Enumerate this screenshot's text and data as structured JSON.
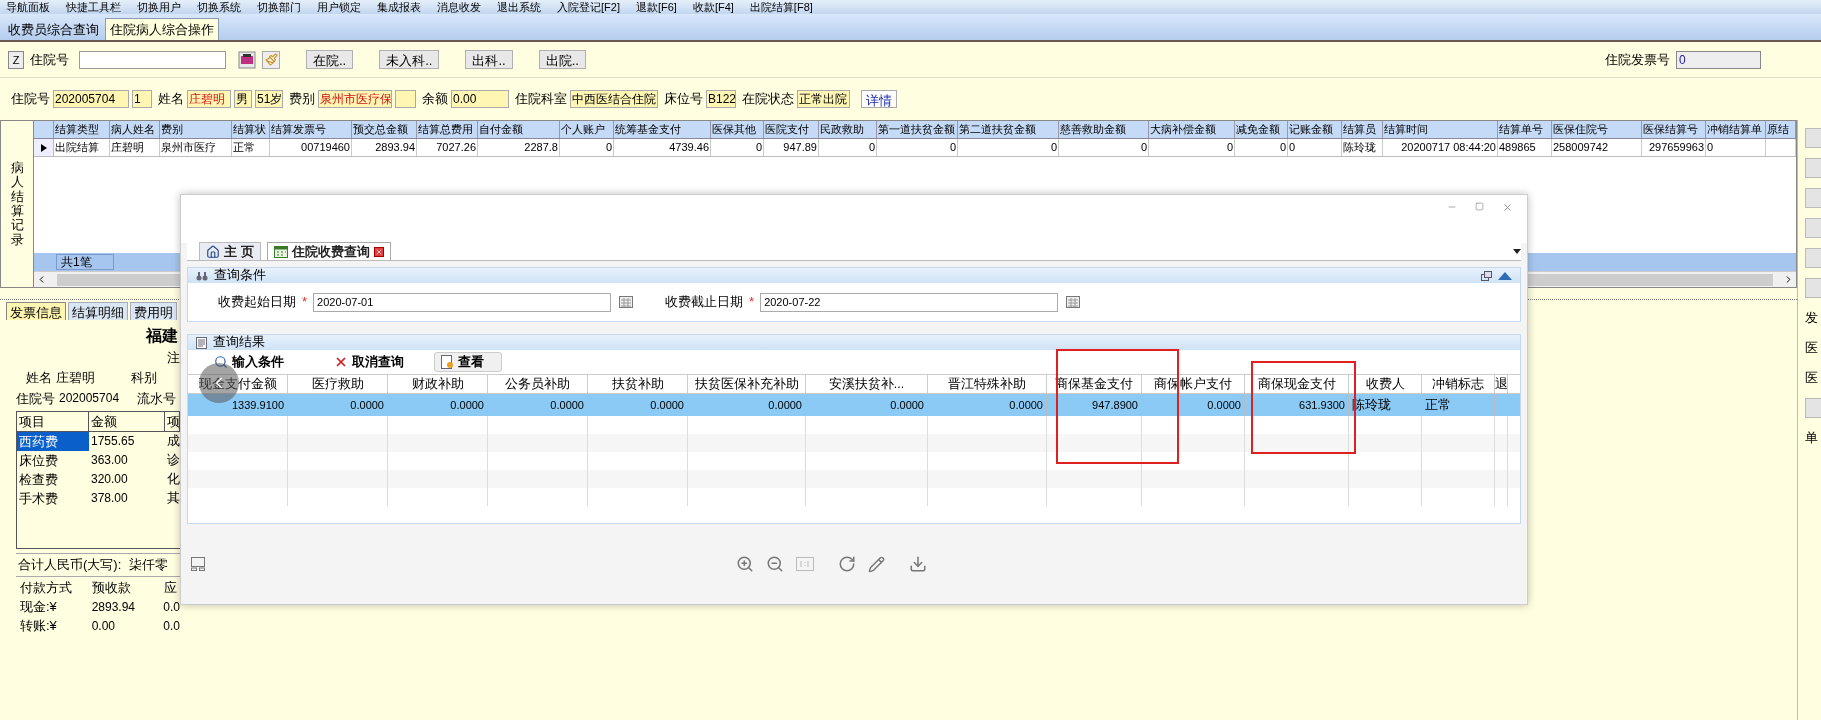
{
  "toolbar": [
    "导航面板",
    "快捷工具栏",
    "切换用户",
    "切换系统",
    "切换部门",
    "用户锁定",
    "集成报表",
    "消息收发",
    "退出系统",
    "入院登记[F2]",
    "退款[F6]",
    "收款[F4]",
    "出院结算[F8]"
  ],
  "main_tabs": [
    {
      "label": "收费员综合查询",
      "selected": false
    },
    {
      "label": "住院病人综合操作",
      "selected": true
    }
  ],
  "search_row": {
    "z_button": "Z",
    "label": "住院号",
    "buttons": [
      "在院..",
      "未入科..",
      "出科..",
      "出院.."
    ],
    "invoice_label": "住院发票号",
    "invoice_value": "0"
  },
  "patient_row": [
    {
      "kind": "label",
      "text": "住院号"
    },
    {
      "kind": "field",
      "value": "202005704",
      "emphasis": false
    },
    {
      "kind": "field",
      "value": "1",
      "emphasis": false
    },
    {
      "kind": "label",
      "text": "姓名"
    },
    {
      "kind": "field",
      "value": "庄碧明",
      "emphasis": true
    },
    {
      "kind": "field",
      "value": "男",
      "emphasis": false
    },
    {
      "kind": "field",
      "value": "51岁",
      "emphasis": false
    },
    {
      "kind": "label",
      "text": "费别"
    },
    {
      "kind": "field",
      "value": "泉州市医疗保",
      "emphasis": true
    },
    {
      "kind": "field"
    },
    {
      "kind": "label",
      "text": "余额"
    },
    {
      "kind": "field",
      "value": "0.00",
      "emphasis": false
    },
    {
      "kind": "label",
      "text": "住院科室"
    },
    {
      "kind": "field",
      "value": "中西医结合住院",
      "emphasis": false
    },
    {
      "kind": "label",
      "text": "床位号"
    },
    {
      "kind": "field",
      "value": "B122",
      "emphasis": false
    },
    {
      "kind": "label",
      "text": "在院状态"
    },
    {
      "kind": "field",
      "value": "正常出院",
      "emphasis": false
    },
    {
      "kind": "button",
      "text": "详情"
    }
  ],
  "settlement_grid": {
    "side_label": "病人结算记录",
    "columns": [
      "结算类型",
      "病人姓名",
      "费别",
      "结算状",
      "结算发票号",
      "预交总金额",
      "结算总费用",
      "自付金额",
      "个人账户",
      "统筹基金支付",
      "医保其他",
      "医院支付",
      "民政救助",
      "第一道扶贫金额",
      "第二道扶贫金额",
      "慈善救助金额",
      "大病补偿金额",
      "减免金额",
      "记账金额",
      "结算员",
      "结算时间",
      "结算单号",
      "医保住院号",
      "医保结算号",
      "冲销结算单",
      "原结"
    ],
    "rows": [
      {
        "selected": true,
        "cells": [
          "出院结算",
          "庄碧明",
          "泉州市医疗",
          "正常",
          "00719460",
          "2893.94",
          "7027.26",
          "2287.8",
          "0",
          "4739.46",
          "0",
          "947.89",
          "0",
          "0",
          "0",
          "0",
          "0",
          "0",
          "0",
          "陈玲珑",
          "20200717 08:44:20",
          "489865",
          "258009742",
          "297659963",
          "0",
          null
        ]
      }
    ],
    "footer": "共1笔"
  },
  "right_strip": [
    {
      "kind": "button"
    },
    {
      "kind": "button"
    },
    {
      "kind": "button"
    },
    {
      "kind": "button"
    },
    {
      "kind": "button"
    },
    {
      "kind": "button"
    },
    {
      "kind": "label",
      "text": "发"
    },
    {
      "kind": "label",
      "text": "医"
    },
    {
      "kind": "label",
      "text": "医"
    },
    {
      "kind": "button"
    },
    {
      "kind": "label",
      "text": "单"
    }
  ],
  "invoice_panel": {
    "tabs": [
      {
        "label": "发票信息",
        "selected": true
      },
      {
        "label": "结算明细",
        "selected": false
      },
      {
        "label": "费用明",
        "selected": false
      }
    ],
    "title": "福建",
    "subtitle": "注",
    "name_label": "姓名",
    "name": "庄碧明",
    "dept_label": "科别",
    "admission_label": "住院号",
    "admission_no": "202005704",
    "serial_label": "流水号",
    "item_columns": [
      "项目",
      "金额",
      "项"
    ],
    "items": [
      {
        "name": "西药费",
        "amount": "1755.65",
        "column_3": "成",
        "selected": true
      },
      {
        "name": "床位费",
        "amount": "363.00",
        "column_3": "诊",
        "selected": false
      },
      {
        "name": "检查费",
        "amount": "320.00",
        "column_3": "化",
        "selected": false
      },
      {
        "name": "手术费",
        "amount": "378.00",
        "column_3": "其",
        "selected": false
      }
    ],
    "total_label": "合计人民币(大写):",
    "total_text": "柒仟零",
    "payment_columns": [
      "付款方式",
      "预收款",
      "应"
    ],
    "payments": [
      [
        "现金:¥",
        "2893.94",
        "0.0"
      ],
      [
        "转账:¥",
        "0.00",
        "0.0"
      ]
    ]
  },
  "dialog": {
    "tabs": [
      {
        "label": "主 页",
        "kind": "home",
        "selected": false,
        "closable": false
      },
      {
        "label": "住院收费查询",
        "kind": "table",
        "selected": true,
        "closable": true
      }
    ],
    "conditions_title": "查询条件",
    "required_mark": "*",
    "start_label": "收费起始日期",
    "start_value": "2020-07-01",
    "end_label": "收费截止日期",
    "end_value": "2020-07-22",
    "results_title": "查询结果",
    "actions": [
      {
        "kind": "search",
        "label": "输入条件"
      },
      {
        "kind": "cancel",
        "label": "取消查询"
      },
      {
        "kind": "view",
        "label": "查看"
      }
    ],
    "columns": [
      "现金支付金额",
      "医疗救助",
      "财政补助",
      "公务员补助",
      "扶贫补助",
      "扶贫医保补充补助",
      "安溪扶贫补...",
      "晋江特殊补助",
      "商保基金支付",
      "商保帐户支付",
      "商保现金支付",
      "收费人",
      "冲销标志",
      "退"
    ],
    "rows": [
      {
        "selected": true,
        "cells": [
          "1339.9100",
          "0.0000",
          "0.0000",
          "0.0000",
          "0.0000",
          "0.0000",
          "0.0000",
          "0.0000",
          "947.8900",
          "0.0000",
          "631.9300",
          "陈玲珑",
          "正常",
          null
        ]
      }
    ]
  }
}
